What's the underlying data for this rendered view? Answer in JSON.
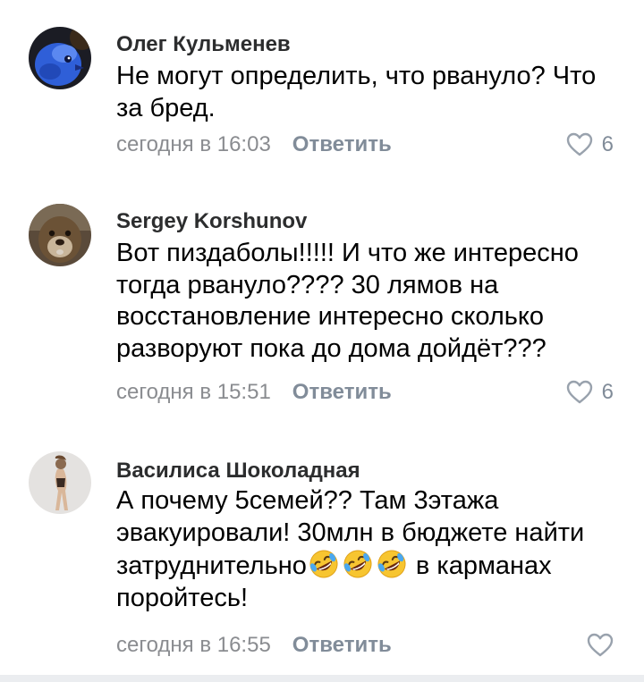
{
  "comments": [
    {
      "author": "Олег Кульменев",
      "text": "Не могут определить, что рвануло? Что за бред.",
      "time": "сегодня в 16:03",
      "reply_label": "Ответить",
      "likes": "6",
      "avatar_icon": "blue-bird-avatar"
    },
    {
      "author": "Sergey Korshunov",
      "text": "Вот пиздаболы!!!!! И что же интересно тогда рвануло???? 30 лямов на восстановление интересно сколько разворуют пока до дома дойдёт???",
      "time": "сегодня в 15:51",
      "reply_label": "Ответить",
      "likes": "6",
      "avatar_icon": "otter-avatar"
    },
    {
      "author": "Василиса Шоколадная",
      "text_before_emoji": "А почему 5семей?? Там 3этажа эвакуировали! 30млн в бюджете найти затруднительно",
      "emoji": "rolling-on-floor-laughing-emoji",
      "text_after_emoji": " в карманах поройтесь!",
      "time": "сегодня в 16:55",
      "reply_label": "Ответить",
      "likes": "",
      "avatar_icon": "woman-figure-avatar"
    }
  ],
  "colors": {
    "author": "#2c2d2e",
    "text": "#000000",
    "meta": "#8a8c90",
    "reply": "#818c99",
    "heart": "#99a2ad"
  }
}
